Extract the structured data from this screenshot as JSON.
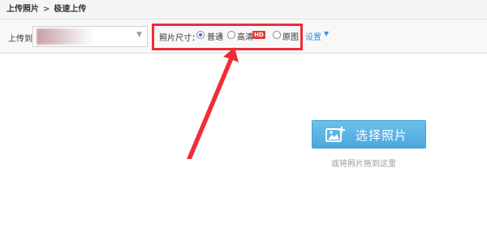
{
  "breadcrumb": {
    "items": [
      "上传照片",
      "极速上传"
    ],
    "separator": ">"
  },
  "toolbar": {
    "upload_to_label": "上传到",
    "photo_size_label": "照片尺寸：",
    "size_options": [
      {
        "label": "普通",
        "checked": true
      },
      {
        "label": "高清",
        "checked": false,
        "badge": "HD"
      },
      {
        "label": "原图",
        "checked": false
      }
    ],
    "settings_label": "设置"
  },
  "main": {
    "select_button_label": "选择照片",
    "drag_hint": "或将照片拖到这里"
  },
  "colors": {
    "highlight": "#ef2d37",
    "button": "#4ca8df",
    "link": "#3a8ee6",
    "hd_badge": "#e23b3b"
  }
}
